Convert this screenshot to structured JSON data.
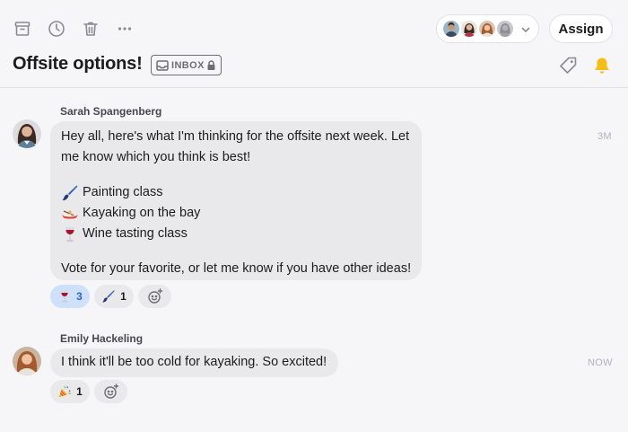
{
  "toolbar": {
    "icons": [
      "archive-icon",
      "clock-icon",
      "trash-icon",
      "more-icon"
    ],
    "assign_label": "Assign"
  },
  "header": {
    "title": "Offsite options!",
    "badge_label": "INBOX",
    "icons": [
      "tag-icon",
      "bell-icon"
    ]
  },
  "colors": {
    "accent_blue": "#2b63c9",
    "reaction_selected_bg": "#cfe0fb",
    "bell_yellow": "#f5bd16",
    "bubble_bg": "#e9e9ec"
  },
  "messages": [
    {
      "sender": "Sarah Spangenberg",
      "time": "3M",
      "intro_line1": "Hey all, here's what I'm thinking for the offsite next week. Let",
      "intro_line2": "me know which you think is best!",
      "options": [
        {
          "icon": "paintbrush-icon",
          "label": "Painting class"
        },
        {
          "icon": "canoe-icon",
          "label": "Kayaking on the bay"
        },
        {
          "icon": "wine-glass-icon",
          "label": "Wine tasting class"
        }
      ],
      "outro": "Vote for your favorite, or let me know if you have other ideas!",
      "reactions": [
        {
          "icon": "wine-glass-icon",
          "count": "3",
          "selected": true
        },
        {
          "icon": "paintbrush-icon",
          "count": "1",
          "selected": false
        }
      ]
    },
    {
      "sender": "Emily Hackeling",
      "time": "NOW",
      "text": "I think it'll be too cold for kayaking. So excited!",
      "reactions": [
        {
          "icon": "party-popper-icon",
          "count": "1",
          "selected": false
        }
      ]
    }
  ]
}
